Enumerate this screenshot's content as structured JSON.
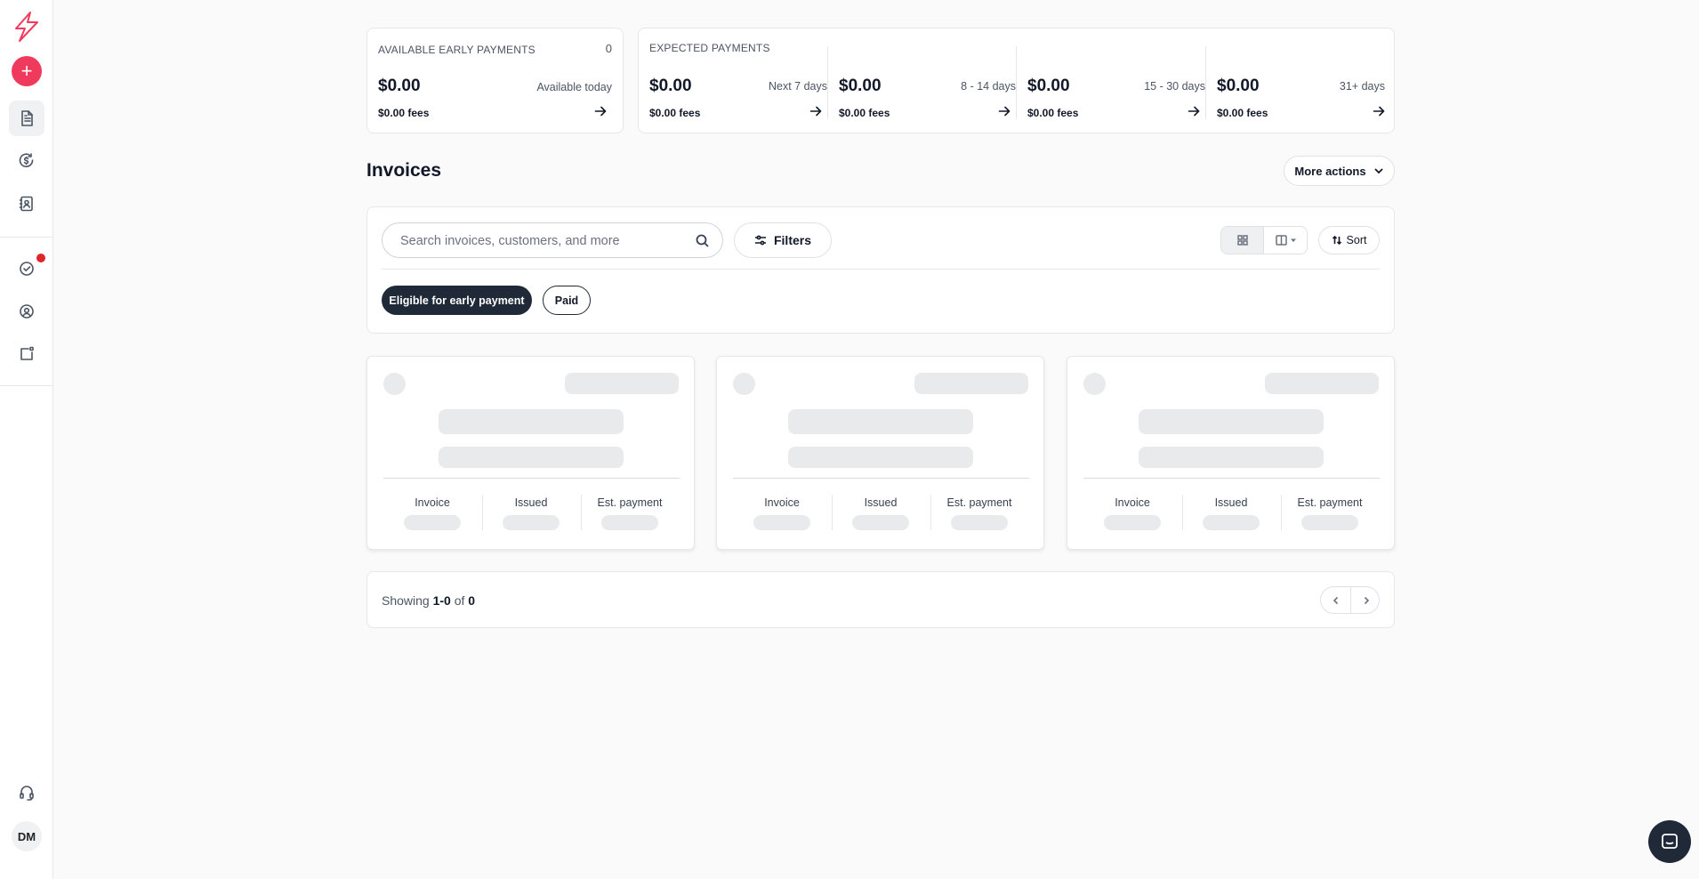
{
  "sidebar": {
    "new_label": "+",
    "avatar_initials": "DM",
    "icons": [
      "logo-bolt-icon",
      "plus-icon",
      "invoice-document-icon",
      "dollar-cycle-icon",
      "contacts-book-icon",
      "check-circle-icon",
      "user-circle-icon",
      "external-box-icon",
      "headset-icon"
    ]
  },
  "early": {
    "label": "AVAILABLE EARLY PAYMENTS",
    "count": "0",
    "amount": "$0.00",
    "range": "Available today",
    "fees": "$0.00 fees"
  },
  "expected": {
    "label": "EXPECTED PAYMENTS",
    "buckets": [
      {
        "amount": "$0.00",
        "range": "Next 7 days",
        "fees": "$0.00 fees"
      },
      {
        "amount": "$0.00",
        "range": "8 - 14 days",
        "fees": "$0.00 fees"
      },
      {
        "amount": "$0.00",
        "range": "15 - 30 days",
        "fees": "$0.00 fees"
      },
      {
        "amount": "$0.00",
        "range": "31+ days",
        "fees": "$0.00 fees"
      }
    ]
  },
  "invoices": {
    "title": "Invoices",
    "more_actions": "More actions",
    "search_placeholder": "Search invoices, customers, and more",
    "filters_label": "Filters",
    "sort_label": "Sort",
    "chips": [
      "Eligible for early payment",
      "Paid"
    ],
    "card_columns": [
      "Invoice",
      "Issued",
      "Est. payment"
    ]
  },
  "pagination": {
    "prefix": "Showing",
    "range": "1-0",
    "of": "of",
    "total": "0"
  },
  "colors": {
    "brand": "#ef3a5d",
    "dark": "#1f2937",
    "notification": "#e0242b"
  }
}
